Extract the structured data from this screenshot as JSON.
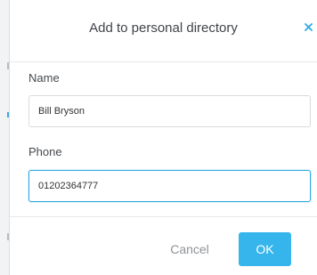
{
  "dialog": {
    "title": "Add to personal directory",
    "close_icon": "close-icon"
  },
  "form": {
    "name": {
      "label": "Name",
      "value": "Bill Bryson"
    },
    "phone": {
      "label": "Phone",
      "value": "01202364777"
    }
  },
  "actions": {
    "cancel_label": "Cancel",
    "ok_label": "OK"
  },
  "colors": {
    "accent": "#35b5ec",
    "close": "#2da9e6",
    "focus_border": "#2da9e6"
  }
}
